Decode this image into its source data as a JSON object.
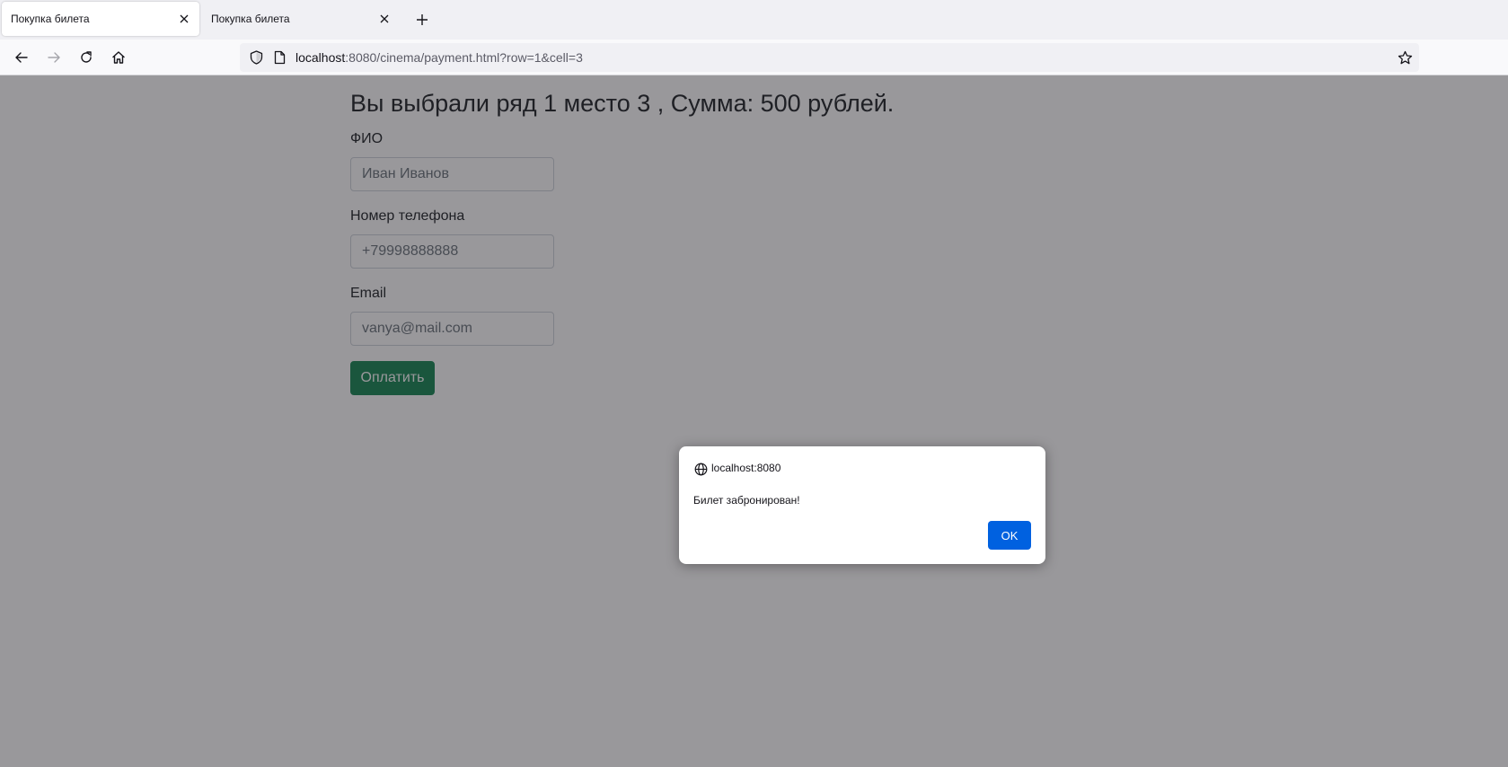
{
  "tabs": [
    {
      "title": "Покупка билета",
      "active": true
    },
    {
      "title": "Покупка билета",
      "active": false
    }
  ],
  "navbar": {
    "url_host": "localhost",
    "url_rest": ":8080/cinema/payment.html?row=1&cell=3"
  },
  "page": {
    "heading": "Вы выбрали ряд 1 место 3 , Сумма: 500 рублей.",
    "fields": [
      {
        "label": "ФИО",
        "placeholder": "Иван Иванов"
      },
      {
        "label": "Номер телефона",
        "placeholder": "+79998888888"
      },
      {
        "label": "Email",
        "placeholder": "vanya@mail.com"
      }
    ],
    "submit_label": "Оплатить"
  },
  "dialog": {
    "origin": "localhost:8080",
    "message": "Билет забронирован!",
    "ok_label": "OK"
  },
  "icons": {
    "back": "arrow-left-icon",
    "forward": "arrow-right-icon",
    "reload": "reload-icon",
    "home": "home-icon",
    "shield": "shield-icon",
    "page": "page-icon",
    "star": "star-icon",
    "close": "close-icon",
    "new_tab": "plus-icon",
    "globe": "globe-icon"
  },
  "colors": {
    "success": "#198754",
    "dialog_button": "#0061e0",
    "text": "#212529"
  }
}
